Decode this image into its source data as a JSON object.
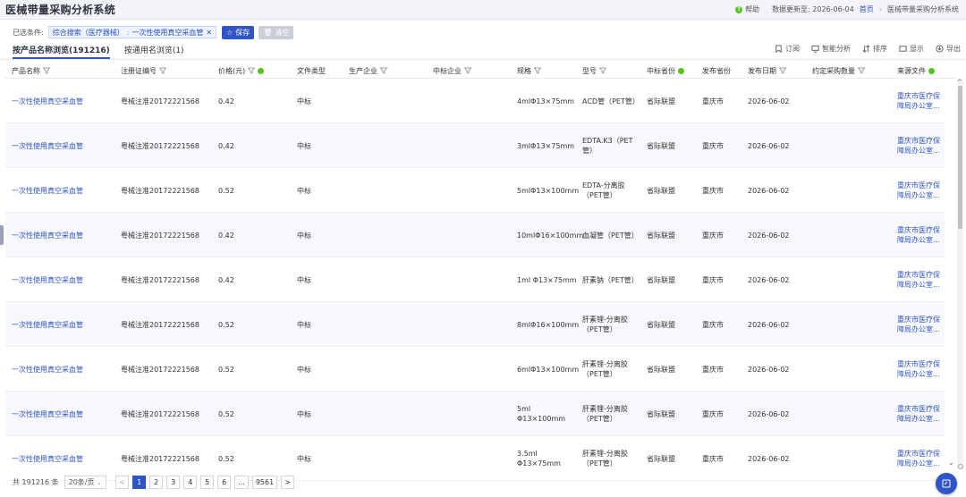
{
  "app": {
    "title": "医械带量采购分析系统"
  },
  "header": {
    "help_label": "帮助",
    "update_label": "数据更新至: 2026-06-04",
    "crumb_home": "首页",
    "crumb_current": "医械带量采购分析系统"
  },
  "filters": {
    "label": "已选条件:",
    "chip_part1": "综合搜索（医疗器械）",
    "chip_part2": "一次性使用真空采血管",
    "chip_close": "✕",
    "save_label": "保存",
    "clear_label": "清空"
  },
  "tabs": [
    {
      "label": "按产品名称浏览(191216)"
    },
    {
      "label": "按通用名浏览(1)"
    }
  ],
  "tools": {
    "subscribe": "订阅",
    "smart_analysis": "智能分析",
    "sort": "排序",
    "display": "显示",
    "export": "导出"
  },
  "columns": {
    "product_name": "产品名称",
    "reg_no": "注册证编号",
    "price": "价格(元)",
    "doc_type": "文件类型",
    "manufacturer": "生产企业",
    "bid_company": "中标企业",
    "spec": "规格",
    "model": "型号",
    "bid_province": "中标省份",
    "pub_province": "发布省份",
    "pub_date": "发布日期",
    "agreed_qty": "约定采购数量",
    "source": "来源文件"
  },
  "rows": [
    {
      "product_name": "一次性使用真空采血管",
      "reg_no": "粤械注准20172221568",
      "price": "0.42",
      "doc_type": "中标",
      "spec": "4mlΦ13×75mm",
      "model": "ACD管（PET管）",
      "bid_province": "省际联盟",
      "pub_province": "重庆市",
      "pub_date": "2026-06-02",
      "source": "重庆市医疗保障局办公室..."
    },
    {
      "product_name": "一次性使用真空采血管",
      "reg_no": "粤械注准20172221568",
      "price": "0.42",
      "doc_type": "中标",
      "spec": "3mlΦ13×75mm",
      "model": "EDTA.K3（PET管）",
      "bid_province": "省际联盟",
      "pub_province": "重庆市",
      "pub_date": "2026-06-02",
      "source": "重庆市医疗保障局办公室..."
    },
    {
      "product_name": "一次性使用真空采血管",
      "reg_no": "粤械注准20172221568",
      "price": "0.52",
      "doc_type": "中标",
      "spec": "5mlΦ13×100mm",
      "model": "EDTA-分离胶（PET管）",
      "bid_province": "省际联盟",
      "pub_province": "重庆市",
      "pub_date": "2026-06-02",
      "source": "重庆市医疗保障局办公室..."
    },
    {
      "product_name": "一次性使用真空采血管",
      "reg_no": "粤械注准20172221568",
      "price": "0.42",
      "doc_type": "中标",
      "spec": "10mlΦ16×100mm",
      "model": "血凝管（PET管）",
      "bid_province": "省际联盟",
      "pub_province": "重庆市",
      "pub_date": "2026-06-02",
      "source": "重庆市医疗保障局办公室..."
    },
    {
      "product_name": "一次性使用真空采血管",
      "reg_no": "粤械注准20172221568",
      "price": "0.42",
      "doc_type": "中标",
      "spec": "1ml Φ13×75mm",
      "model": "肝素钠（PET管）",
      "bid_province": "省际联盟",
      "pub_province": "重庆市",
      "pub_date": "2026-06-02",
      "source": "重庆市医疗保障局办公室..."
    },
    {
      "product_name": "一次性使用真空采血管",
      "reg_no": "粤械注准20172221568",
      "price": "0.52",
      "doc_type": "中标",
      "spec": "8mlΦ16×100mm",
      "model": "肝素锂-分离胶（PET管）",
      "bid_province": "省际联盟",
      "pub_province": "重庆市",
      "pub_date": "2026-06-02",
      "source": "重庆市医疗保障局办公室..."
    },
    {
      "product_name": "一次性使用真空采血管",
      "reg_no": "粤械注准20172221568",
      "price": "0.52",
      "doc_type": "中标",
      "spec": "6mlΦ13×100mm",
      "model": "肝素锂-分离胶（PET管）",
      "bid_province": "省际联盟",
      "pub_province": "重庆市",
      "pub_date": "2026-06-02",
      "source": "重庆市医疗保障局办公室..."
    },
    {
      "product_name": "一次性使用真空采血管",
      "reg_no": "粤械注准20172221568",
      "price": "0.52",
      "doc_type": "中标",
      "spec": "5ml Φ13×100mm",
      "model": "肝素锂-分离胶（PET管）",
      "bid_province": "省际联盟",
      "pub_province": "重庆市",
      "pub_date": "2026-06-02",
      "source": "重庆市医疗保障局办公室..."
    },
    {
      "product_name": "一次性使用真空采血管",
      "reg_no": "粤械注准20172221568",
      "price": "0.52",
      "doc_type": "中标",
      "spec": "3.5ml Φ13×75mm",
      "model": "肝素锂-分离胶（PET管）",
      "bid_province": "省际联盟",
      "pub_province": "重庆市",
      "pub_date": "2026-06-02",
      "source": "重庆市医疗保障局办公室..."
    }
  ],
  "pagination": {
    "total": "共 191216 条",
    "page_size": "20条/页",
    "prev": "<",
    "pages": [
      "1",
      "2",
      "3",
      "4",
      "5",
      "6",
      "...",
      "9561"
    ],
    "next": ">"
  },
  "colors": {
    "accent": "#2f54c6",
    "info": "#52c41a"
  }
}
